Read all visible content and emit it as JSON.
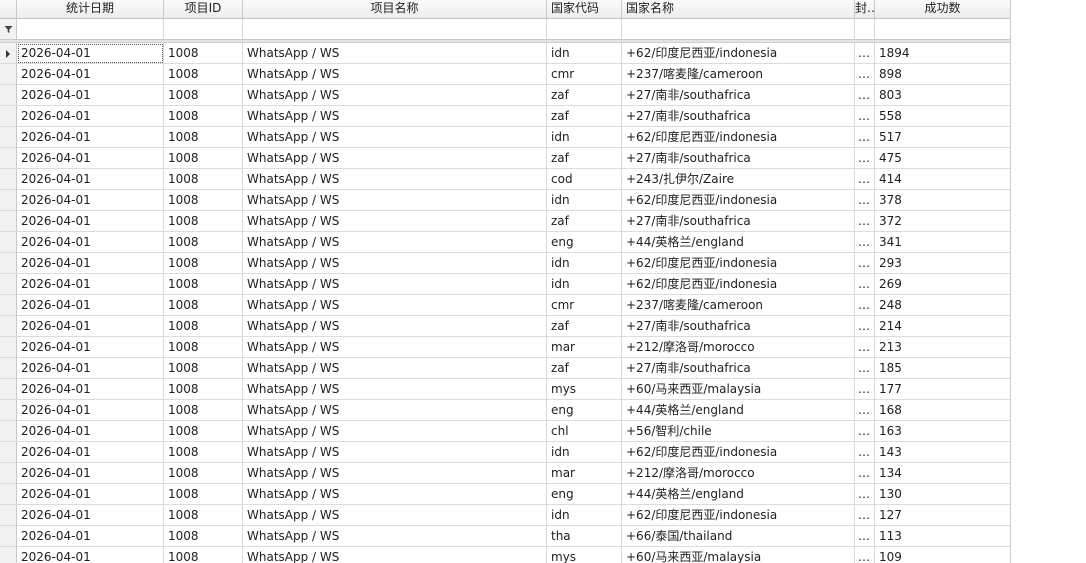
{
  "columns": {
    "date": "统计日期",
    "project_id": "项目ID",
    "project_name": "项目名称",
    "country_code": "国家代码",
    "country_name": "国家名称",
    "truncated": "封…",
    "success_count": "成功数"
  },
  "filter_icon": "funnel-icon",
  "rows": [
    {
      "date": "2026-04-01",
      "pid": "1008",
      "pname": "WhatsApp / WS",
      "code": "idn",
      "cname": "+62/印度尼西亚/indonesia",
      "small": "…",
      "count": "1894"
    },
    {
      "date": "2026-04-01",
      "pid": "1008",
      "pname": "WhatsApp / WS",
      "code": "cmr",
      "cname": "+237/喀麦隆/cameroon",
      "small": "…",
      "count": "898"
    },
    {
      "date": "2026-04-01",
      "pid": "1008",
      "pname": "WhatsApp / WS",
      "code": "zaf",
      "cname": "+27/南非/southafrica",
      "small": "…",
      "count": "803"
    },
    {
      "date": "2026-04-01",
      "pid": "1008",
      "pname": "WhatsApp / WS",
      "code": "zaf",
      "cname": "+27/南非/southafrica",
      "small": "…",
      "count": "558"
    },
    {
      "date": "2026-04-01",
      "pid": "1008",
      "pname": "WhatsApp / WS",
      "code": "idn",
      "cname": "+62/印度尼西亚/indonesia",
      "small": "…",
      "count": "517"
    },
    {
      "date": "2026-04-01",
      "pid": "1008",
      "pname": "WhatsApp / WS",
      "code": "zaf",
      "cname": "+27/南非/southafrica",
      "small": "…",
      "count": "475"
    },
    {
      "date": "2026-04-01",
      "pid": "1008",
      "pname": "WhatsApp / WS",
      "code": "cod",
      "cname": "+243/扎伊尔/Zaire",
      "small": "…",
      "count": "414"
    },
    {
      "date": "2026-04-01",
      "pid": "1008",
      "pname": "WhatsApp / WS",
      "code": "idn",
      "cname": "+62/印度尼西亚/indonesia",
      "small": "…",
      "count": "378"
    },
    {
      "date": "2026-04-01",
      "pid": "1008",
      "pname": "WhatsApp / WS",
      "code": "zaf",
      "cname": "+27/南非/southafrica",
      "small": "…",
      "count": "372"
    },
    {
      "date": "2026-04-01",
      "pid": "1008",
      "pname": "WhatsApp / WS",
      "code": "eng",
      "cname": "+44/英格兰/england",
      "small": "…",
      "count": "341"
    },
    {
      "date": "2026-04-01",
      "pid": "1008",
      "pname": "WhatsApp / WS",
      "code": "idn",
      "cname": "+62/印度尼西亚/indonesia",
      "small": "…",
      "count": "293"
    },
    {
      "date": "2026-04-01",
      "pid": "1008",
      "pname": "WhatsApp / WS",
      "code": "idn",
      "cname": "+62/印度尼西亚/indonesia",
      "small": "…",
      "count": "269"
    },
    {
      "date": "2026-04-01",
      "pid": "1008",
      "pname": "WhatsApp / WS",
      "code": "cmr",
      "cname": "+237/喀麦隆/cameroon",
      "small": "…",
      "count": "248"
    },
    {
      "date": "2026-04-01",
      "pid": "1008",
      "pname": "WhatsApp / WS",
      "code": "zaf",
      "cname": "+27/南非/southafrica",
      "small": "…",
      "count": "214"
    },
    {
      "date": "2026-04-01",
      "pid": "1008",
      "pname": "WhatsApp / WS",
      "code": "mar",
      "cname": "+212/摩洛哥/morocco",
      "small": "…",
      "count": "213"
    },
    {
      "date": "2026-04-01",
      "pid": "1008",
      "pname": "WhatsApp / WS",
      "code": "zaf",
      "cname": "+27/南非/southafrica",
      "small": "…",
      "count": "185"
    },
    {
      "date": "2026-04-01",
      "pid": "1008",
      "pname": "WhatsApp / WS",
      "code": "mys",
      "cname": "+60/马来西亚/malaysia",
      "small": "…",
      "count": "177"
    },
    {
      "date": "2026-04-01",
      "pid": "1008",
      "pname": "WhatsApp / WS",
      "code": "eng",
      "cname": "+44/英格兰/england",
      "small": "…",
      "count": "168"
    },
    {
      "date": "2026-04-01",
      "pid": "1008",
      "pname": "WhatsApp / WS",
      "code": "chl",
      "cname": "+56/智利/chile",
      "small": "…",
      "count": "163"
    },
    {
      "date": "2026-04-01",
      "pid": "1008",
      "pname": "WhatsApp / WS",
      "code": "idn",
      "cname": "+62/印度尼西亚/indonesia",
      "small": "…",
      "count": "143"
    },
    {
      "date": "2026-04-01",
      "pid": "1008",
      "pname": "WhatsApp / WS",
      "code": "mar",
      "cname": "+212/摩洛哥/morocco",
      "small": "…",
      "count": "134"
    },
    {
      "date": "2026-04-01",
      "pid": "1008",
      "pname": "WhatsApp / WS",
      "code": "eng",
      "cname": "+44/英格兰/england",
      "small": "…",
      "count": "130"
    },
    {
      "date": "2026-04-01",
      "pid": "1008",
      "pname": "WhatsApp / WS",
      "code": "idn",
      "cname": "+62/印度尼西亚/indonesia",
      "small": "…",
      "count": "127"
    },
    {
      "date": "2026-04-01",
      "pid": "1008",
      "pname": "WhatsApp / WS",
      "code": "tha",
      "cname": "+66/泰国/thailand",
      "small": "…",
      "count": "113"
    },
    {
      "date": "2026-04-01",
      "pid": "1008",
      "pname": "WhatsApp / WS",
      "code": "mys",
      "cname": "+60/马来西亚/malaysia",
      "small": "…",
      "count": "109"
    }
  ],
  "colors": {
    "header_bg": "#f0f0f0",
    "grid_line": "#dcdcdc",
    "indicator_bg": "#f2f2f2"
  }
}
